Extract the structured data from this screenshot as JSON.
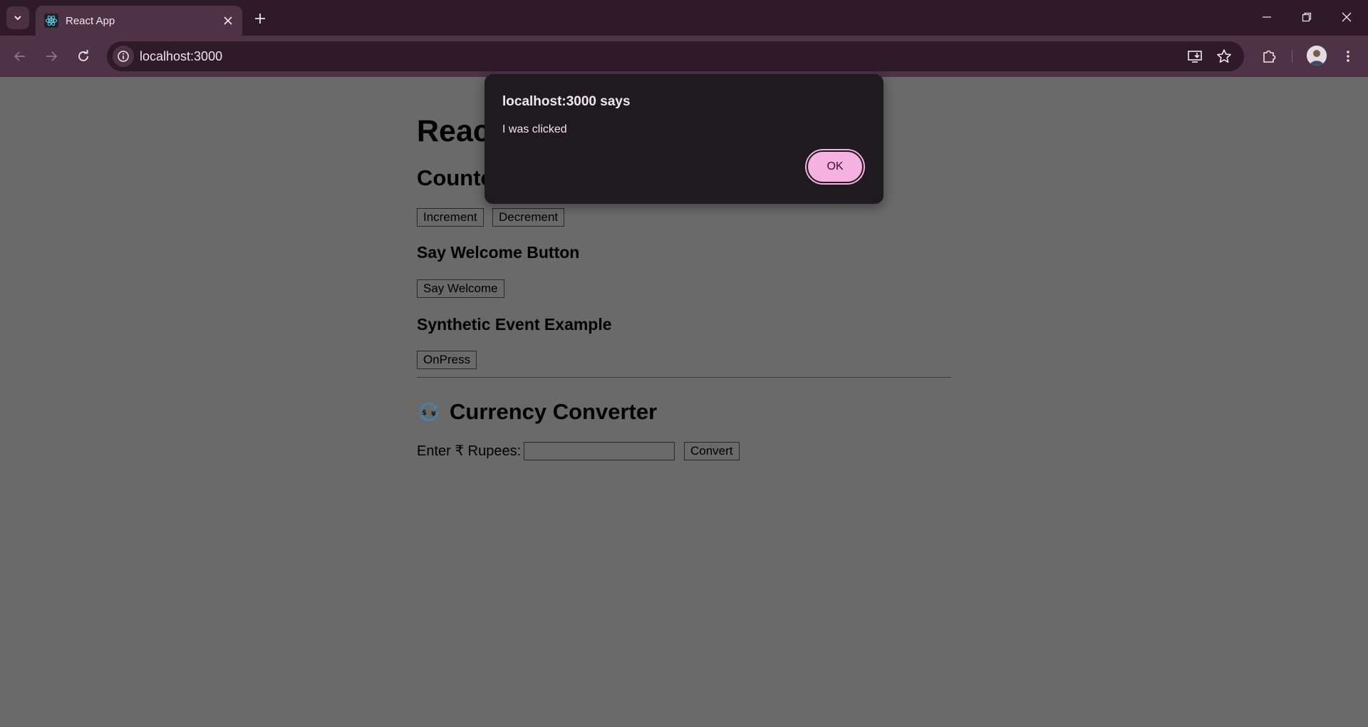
{
  "browser": {
    "tab_title": "React App",
    "url": "localhost:3000",
    "accent": "#4e3246"
  },
  "page": {
    "app_title": "Reac",
    "counter_title": "Counte",
    "increment_label": "Increment",
    "decrement_label": "Decrement",
    "welcome_heading": "Say Welcome Button",
    "welcome_label": "Say Welcome",
    "synthetic_heading": "Synthetic Event Example",
    "onpress_label": "OnPress",
    "currency_heading": "Currency Converter",
    "currency_icon": "currency-exchange-icon",
    "rupee_label": "Enter ₹ Rupees:",
    "rupee_value": "",
    "convert_label": "Convert"
  },
  "dialog": {
    "title": "localhost:3000 says",
    "message": "I was clicked",
    "ok_label": "OK",
    "ok_color": "#f5b2e0"
  }
}
